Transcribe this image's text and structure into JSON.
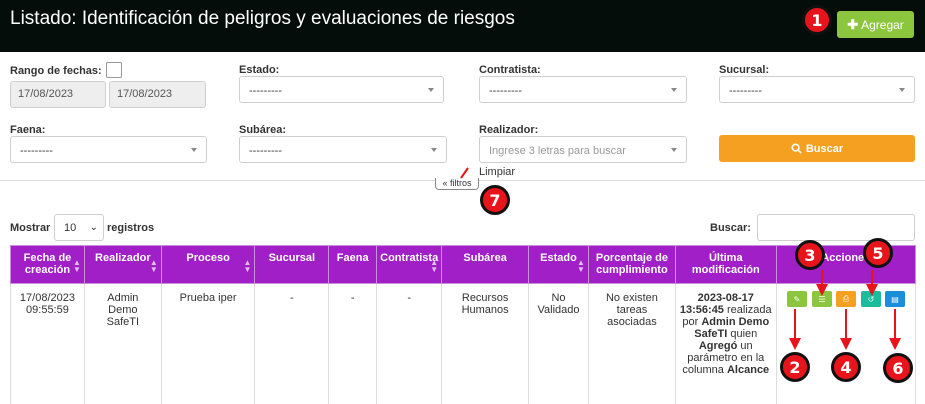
{
  "header": {
    "title": "Listado: Identificación de peligros y evaluaciones de riesgos",
    "add_button": "Agregar",
    "add_icon": "plus-icon"
  },
  "filters": {
    "date_range_label": "Rango de fechas:",
    "date_from": "17/08/2023",
    "date_to": "17/08/2023",
    "estado_label": "Estado:",
    "estado_value": "---------",
    "contratista_label": "Contratista:",
    "contratista_value": "---------",
    "sucursal_label": "Sucursal:",
    "sucursal_value": "---------",
    "faena_label": "Faena:",
    "faena_value": "---------",
    "subarea_label": "Subárea:",
    "subarea_value": "---------",
    "realizador_label": "Realizador:",
    "realizador_placeholder": "Ingrese 3 letras para buscar",
    "search_button": "Buscar",
    "clear_label": "Limpiar",
    "toggle_label": "filtros"
  },
  "table_controls": {
    "show_label": "Mostrar",
    "page_length": "10",
    "records_label": "registros",
    "search_label": "Buscar:"
  },
  "table": {
    "headers": [
      "Fecha de creación",
      "Realizador",
      "Proceso",
      "Sucursal",
      "Faena",
      "Contratista",
      "Subárea",
      "Estado",
      "Porcentaje de cumplimiento",
      "Última modificación",
      "Acciones"
    ],
    "row": {
      "fecha": "17/08/2023 09:55:59",
      "realizador": "Admin Demo SafeTI",
      "proceso": "Prueba iper",
      "sucursal": "-",
      "faena": "-",
      "contratista": "-",
      "subarea": "Recursos Humanos",
      "estado": "No Validado",
      "porcentaje": "No existen tareas asociadas",
      "ultima_fecha": "2023-08-17 13:56:45",
      "ultima_t1": "realizada por",
      "ultima_user": "Admin Demo SafeTI",
      "ultima_t2": "quien",
      "ultima_action": "Agregó",
      "ultima_t3": "un parámetro en la columna",
      "ultima_column": "Alcance"
    }
  },
  "markers": [
    "1",
    "2",
    "3",
    "4",
    "5",
    "6",
    "7"
  ],
  "colors": {
    "header_bg": "#050d0a",
    "add_button": "#8cc63f",
    "search_button": "#f5a020",
    "table_header": "#a01fc7",
    "marker": "#e8141b"
  }
}
